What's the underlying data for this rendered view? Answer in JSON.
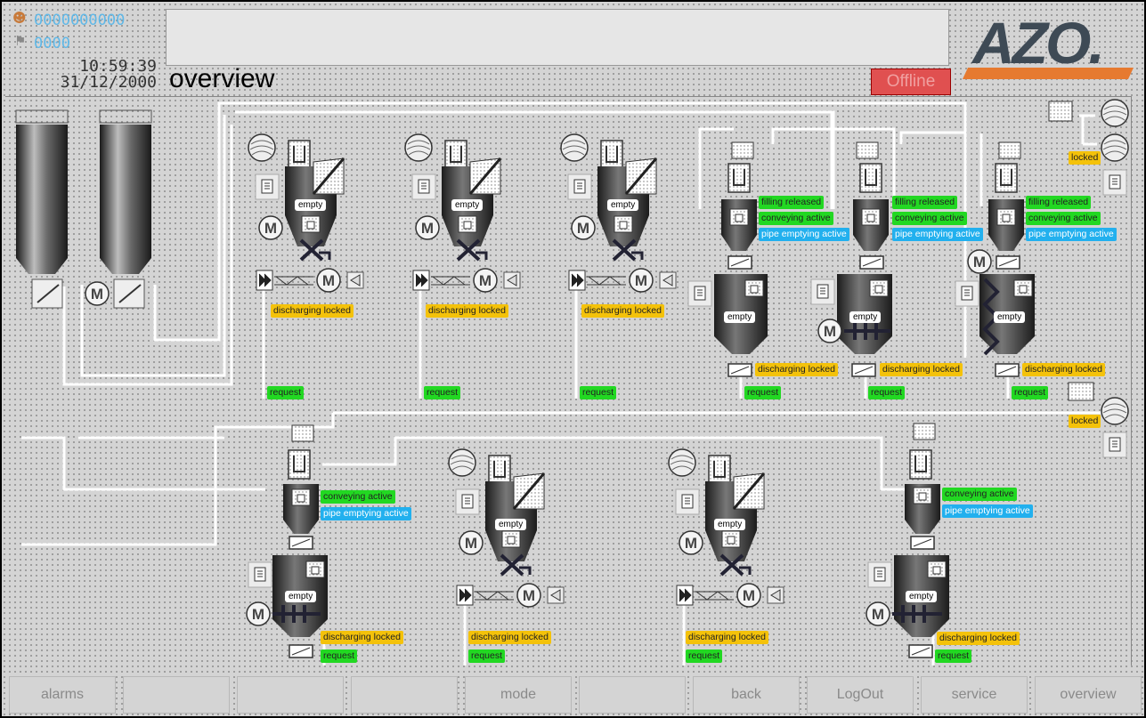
{
  "header": {
    "user_id": "0000000000",
    "user_level": "0000",
    "time": "10:59:39",
    "date": "31/12/2000",
    "page_title": "overview",
    "connection_status": "Offline",
    "logo_text": "AZO.",
    "icons": [
      "user-icon",
      "key-icon"
    ]
  },
  "status_labels": {
    "discharging_locked": "discharging locked",
    "request": "request",
    "filling_released": "filling released",
    "conveying_active": "conveying active",
    "pipe_emptying_active": "pipe emptying active",
    "locked": "locked",
    "empty": "empty"
  },
  "colors": {
    "status_green": "#22d822",
    "status_yellow": "#f4c20a",
    "status_blue": "#22b0ee",
    "offline_red": "#e05050",
    "logo_orange": "#e67a30"
  },
  "footer": {
    "buttons": [
      "alarms",
      "",
      "",
      "",
      "mode",
      "",
      "back",
      "LogOut",
      "service",
      "overview"
    ]
  }
}
